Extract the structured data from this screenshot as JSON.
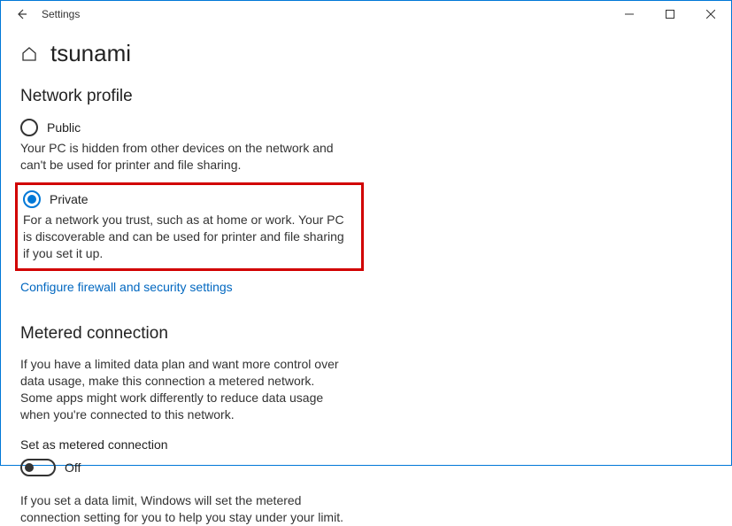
{
  "window": {
    "app_title": "Settings"
  },
  "header": {
    "page_title": "tsunami"
  },
  "network_profile": {
    "heading": "Network profile",
    "public": {
      "label": "Public",
      "description": "Your PC is hidden from other devices on the network and can't be used for printer and file sharing."
    },
    "private": {
      "label": "Private",
      "description": "For a network you trust, such as at home or work. Your PC is discoverable and can be used for printer and file sharing if you set it up."
    },
    "link": "Configure firewall and security settings"
  },
  "metered": {
    "heading": "Metered connection",
    "description": "If you have a limited data plan and want more control over data usage, make this connection a metered network. Some apps might work differently to reduce data usage when you're connected to this network.",
    "toggle_label": "Set as metered connection",
    "toggle_state": "Off",
    "data_limit_text": "If you set a data limit, Windows will set the metered connection setting for you to help you stay under your limit."
  }
}
